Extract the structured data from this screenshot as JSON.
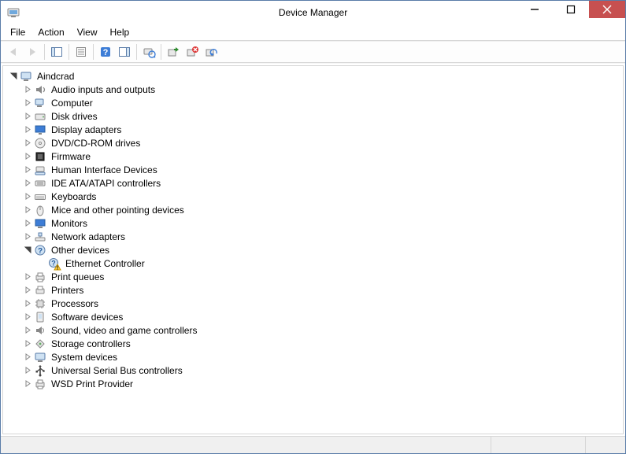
{
  "window": {
    "title": "Device Manager"
  },
  "menu": {
    "items": [
      "File",
      "Action",
      "View",
      "Help"
    ]
  },
  "toolbar": {
    "buttons": [
      {
        "name": "back-button",
        "icon": "arrow-left",
        "enabled": false
      },
      {
        "name": "forward-button",
        "icon": "arrow-right",
        "enabled": false
      },
      {
        "sep": true
      },
      {
        "name": "show-hide-tree-button",
        "icon": "tree-pane",
        "enabled": true
      },
      {
        "sep": true
      },
      {
        "name": "properties-button",
        "icon": "properties",
        "enabled": true
      },
      {
        "sep": true
      },
      {
        "name": "help-button",
        "icon": "help",
        "enabled": true
      },
      {
        "name": "action-button",
        "icon": "action-pane",
        "enabled": true
      },
      {
        "sep": true
      },
      {
        "name": "scan-hardware-button",
        "icon": "scan",
        "enabled": true
      },
      {
        "sep": true
      },
      {
        "name": "update-driver-button",
        "icon": "update-driver",
        "enabled": true
      },
      {
        "name": "uninstall-button",
        "icon": "uninstall",
        "enabled": true
      },
      {
        "name": "add-legacy-button",
        "icon": "add-legacy",
        "enabled": true
      }
    ]
  },
  "tree": {
    "root": {
      "label": "Aindcrad",
      "icon": "computer",
      "expanded": true,
      "children": [
        {
          "label": "Audio inputs and outputs",
          "icon": "audio",
          "expandable": true
        },
        {
          "label": "Computer",
          "icon": "computer-small",
          "expandable": true
        },
        {
          "label": "Disk drives",
          "icon": "disk",
          "expandable": true
        },
        {
          "label": "Display adapters",
          "icon": "display",
          "expandable": true
        },
        {
          "label": "DVD/CD-ROM drives",
          "icon": "dvd",
          "expandable": true
        },
        {
          "label": "Firmware",
          "icon": "firmware",
          "expandable": true
        },
        {
          "label": "Human Interface Devices",
          "icon": "hid",
          "expandable": true
        },
        {
          "label": "IDE ATA/ATAPI controllers",
          "icon": "ide",
          "expandable": true
        },
        {
          "label": "Keyboards",
          "icon": "keyboard",
          "expandable": true
        },
        {
          "label": "Mice and other pointing devices",
          "icon": "mouse",
          "expandable": true
        },
        {
          "label": "Monitors",
          "icon": "monitor",
          "expandable": true
        },
        {
          "label": "Network adapters",
          "icon": "network",
          "expandable": true
        },
        {
          "label": "Other devices",
          "icon": "other",
          "expandable": true,
          "expanded": true,
          "children": [
            {
              "label": "Ethernet Controller",
              "icon": "unknown-warn",
              "expandable": false
            }
          ]
        },
        {
          "label": "Print queues",
          "icon": "printqueue",
          "expandable": true
        },
        {
          "label": "Printers",
          "icon": "printer",
          "expandable": true
        },
        {
          "label": "Processors",
          "icon": "cpu",
          "expandable": true
        },
        {
          "label": "Software devices",
          "icon": "software",
          "expandable": true
        },
        {
          "label": "Sound, video and game controllers",
          "icon": "sound",
          "expandable": true
        },
        {
          "label": "Storage controllers",
          "icon": "storage",
          "expandable": true
        },
        {
          "label": "System devices",
          "icon": "system",
          "expandable": true
        },
        {
          "label": "Universal Serial Bus controllers",
          "icon": "usb",
          "expandable": true
        },
        {
          "label": "WSD Print Provider",
          "icon": "printqueue",
          "expandable": true
        }
      ]
    }
  }
}
